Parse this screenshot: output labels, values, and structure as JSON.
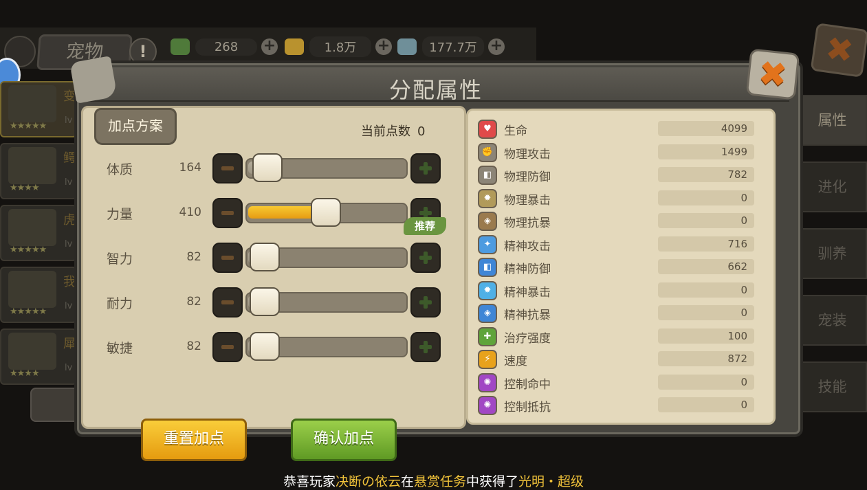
{
  "background": {
    "tab_label": "宠物",
    "help_label": "!",
    "currencies": [
      {
        "icon": "green-leaf-currency-icon",
        "value": "268",
        "color": "#4f7a3a"
      },
      {
        "icon": "gold-ore-currency-icon",
        "value": "1.8万",
        "color": "#b9922e"
      },
      {
        "icon": "shell-currency-icon",
        "value": "177.7万",
        "color": "#6f8f99"
      }
    ],
    "close_glyph": "✖",
    "pet_list": [
      {
        "name": "变",
        "lv": "lv",
        "stars": "★★★★★"
      },
      {
        "name": "鳄",
        "lv": "lv",
        "stars": "★★★★"
      },
      {
        "name": "虎",
        "lv": "lv",
        "stars": "★★★★★"
      },
      {
        "name": "我",
        "lv": "lv",
        "stars": "★★★★★"
      },
      {
        "name": "犀",
        "lv": "lv",
        "stars": "★★★★"
      }
    ],
    "side_tabs": [
      "属性",
      "进化",
      "驯养",
      "宠装",
      "技能"
    ],
    "broadcast": {
      "p1": "恭喜玩家",
      "player": "决断の依云",
      "p2": "在",
      "task": "悬赏任务",
      "p3": "中获得了",
      "item": "光明・超级"
    }
  },
  "dialog": {
    "title": "分配属性",
    "close_glyph": "✖",
    "plan_button": "加点方案",
    "points_label": "当前点数",
    "points_value": "0",
    "attributes": [
      {
        "label": "体质",
        "value": "164",
        "slider_fraction": 0.15
      },
      {
        "label": "力量",
        "value": "410",
        "slider_fraction": 0.52
      },
      {
        "label": "智力",
        "value": "82",
        "slider_fraction": 0.03
      },
      {
        "label": "耐力",
        "value": "82",
        "slider_fraction": 0.03
      },
      {
        "label": "敏捷",
        "value": "82",
        "slider_fraction": 0.03
      }
    ],
    "recommend_label": "推荐",
    "reset_button": "重置加点",
    "confirm_button": "确认加点",
    "stats": [
      {
        "label": "生命",
        "value": "4099",
        "icon": "heart-icon",
        "color": "#e04a4a",
        "glyph": "♥"
      },
      {
        "label": "物理攻击",
        "value": "1499",
        "icon": "fist-attack-icon",
        "color": "#8c8577",
        "glyph": "✊"
      },
      {
        "label": "物理防御",
        "value": "782",
        "icon": "shield-icon",
        "color": "#8c8577",
        "glyph": "◧"
      },
      {
        "label": "物理暴击",
        "value": "0",
        "icon": "critical-strike-icon",
        "color": "#b19a5a",
        "glyph": "✹"
      },
      {
        "label": "物理抗暴",
        "value": "0",
        "icon": "crit-resist-icon",
        "color": "#9a7a4e",
        "glyph": "◈"
      },
      {
        "label": "精神攻击",
        "value": "716",
        "icon": "spirit-attack-icon",
        "color": "#4d9be0",
        "glyph": "✦"
      },
      {
        "label": "精神防御",
        "value": "662",
        "icon": "spirit-shield-icon",
        "color": "#3f86d6",
        "glyph": "◧"
      },
      {
        "label": "精神暴击",
        "value": "0",
        "icon": "spirit-critical-icon",
        "color": "#4fb0e6",
        "glyph": "✹"
      },
      {
        "label": "精神抗暴",
        "value": "0",
        "icon": "spirit-crit-resist-icon",
        "color": "#3f86d6",
        "glyph": "◈"
      },
      {
        "label": "治疗强度",
        "value": "100",
        "icon": "heal-cross-icon",
        "color": "#5fa43a",
        "glyph": "✚"
      },
      {
        "label": "速度",
        "value": "872",
        "icon": "lightning-icon",
        "color": "#e8a21c",
        "glyph": "⚡"
      },
      {
        "label": "控制命中",
        "value": "0",
        "icon": "control-hit-icon",
        "color": "#a147c4",
        "glyph": "✺"
      },
      {
        "label": "控制抵抗",
        "value": "0",
        "icon": "control-resist-icon",
        "color": "#a147c4",
        "glyph": "✺"
      }
    ]
  }
}
